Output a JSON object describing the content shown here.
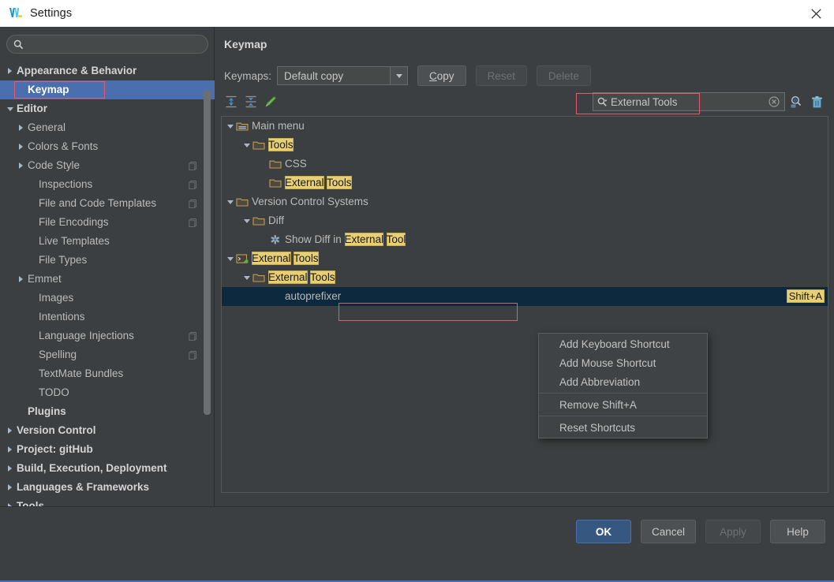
{
  "window": {
    "title": "Settings",
    "logo_icon": "webstorm-logo",
    "close_icon": "close-icon"
  },
  "sidebar": {
    "search": {
      "value": "",
      "placeholder": "",
      "icon": "search-icon"
    },
    "items": [
      {
        "label": "Appearance & Behavior",
        "arrow": "right",
        "bold": true,
        "indent": 0,
        "selected": false,
        "copy_icon": false
      },
      {
        "label": "Keymap",
        "arrow": "none",
        "bold": true,
        "indent": 1,
        "selected": true,
        "copy_icon": false
      },
      {
        "label": "Editor",
        "arrow": "down",
        "bold": true,
        "indent": 0,
        "selected": false,
        "copy_icon": false
      },
      {
        "label": "General",
        "arrow": "right",
        "bold": false,
        "indent": 1,
        "selected": false,
        "copy_icon": false
      },
      {
        "label": "Colors & Fonts",
        "arrow": "right",
        "bold": false,
        "indent": 1,
        "selected": false,
        "copy_icon": false
      },
      {
        "label": "Code Style",
        "arrow": "right",
        "bold": false,
        "indent": 1,
        "selected": false,
        "copy_icon": true
      },
      {
        "label": "Inspections",
        "arrow": "none",
        "bold": false,
        "indent": 2,
        "selected": false,
        "copy_icon": true
      },
      {
        "label": "File and Code Templates",
        "arrow": "none",
        "bold": false,
        "indent": 2,
        "selected": false,
        "copy_icon": true
      },
      {
        "label": "File Encodings",
        "arrow": "none",
        "bold": false,
        "indent": 2,
        "selected": false,
        "copy_icon": true
      },
      {
        "label": "Live Templates",
        "arrow": "none",
        "bold": false,
        "indent": 2,
        "selected": false,
        "copy_icon": false
      },
      {
        "label": "File Types",
        "arrow": "none",
        "bold": false,
        "indent": 2,
        "selected": false,
        "copy_icon": false
      },
      {
        "label": "Emmet",
        "arrow": "right",
        "bold": false,
        "indent": 1,
        "selected": false,
        "copy_icon": false
      },
      {
        "label": "Images",
        "arrow": "none",
        "bold": false,
        "indent": 2,
        "selected": false,
        "copy_icon": false
      },
      {
        "label": "Intentions",
        "arrow": "none",
        "bold": false,
        "indent": 2,
        "selected": false,
        "copy_icon": false
      },
      {
        "label": "Language Injections",
        "arrow": "none",
        "bold": false,
        "indent": 2,
        "selected": false,
        "copy_icon": true
      },
      {
        "label": "Spelling",
        "arrow": "none",
        "bold": false,
        "indent": 2,
        "selected": false,
        "copy_icon": true
      },
      {
        "label": "TextMate Bundles",
        "arrow": "none",
        "bold": false,
        "indent": 2,
        "selected": false,
        "copy_icon": false
      },
      {
        "label": "TODO",
        "arrow": "none",
        "bold": false,
        "indent": 2,
        "selected": false,
        "copy_icon": false
      },
      {
        "label": "Plugins",
        "arrow": "none",
        "bold": true,
        "indent": 1,
        "selected": false,
        "copy_icon": false
      },
      {
        "label": "Version Control",
        "arrow": "right",
        "bold": true,
        "indent": 0,
        "selected": false,
        "copy_icon": false
      },
      {
        "label": "Project: gitHub",
        "arrow": "right",
        "bold": true,
        "indent": 0,
        "selected": false,
        "copy_icon": false
      },
      {
        "label": "Build, Execution, Deployment",
        "arrow": "right",
        "bold": true,
        "indent": 0,
        "selected": false,
        "copy_icon": false
      },
      {
        "label": "Languages & Frameworks",
        "arrow": "right",
        "bold": true,
        "indent": 0,
        "selected": false,
        "copy_icon": false
      },
      {
        "label": "Tools",
        "arrow": "right",
        "bold": true,
        "indent": 0,
        "selected": false,
        "copy_icon": false
      }
    ]
  },
  "main": {
    "title": "Keymap",
    "keymaps_label": "Keymaps:",
    "keymap_selected": "Default copy",
    "buttons": {
      "copy": {
        "label": "Copy",
        "mnemonic": "C",
        "rest": "opy",
        "enabled": true
      },
      "reset": {
        "label": "Reset",
        "enabled": false
      },
      "delete": {
        "label": "Delete",
        "enabled": false
      }
    },
    "toolbar": [
      {
        "name": "expand-all-icon",
        "title": "Expand All"
      },
      {
        "name": "collapse-all-icon",
        "title": "Collapse All"
      },
      {
        "name": "edit-shortcut-icon",
        "title": "Edit Shortcut"
      }
    ],
    "search": {
      "value": "External Tools",
      "icon": "search-icon",
      "clear_icon": "clear-icon",
      "filter_icon": "find-shortcut-icon",
      "trash_icon": "trash-icon"
    }
  },
  "tree": {
    "rows": [
      {
        "indent": 0,
        "arrow": "down",
        "icon": "main-menu-icon",
        "parts": [
          {
            "t": "Main menu",
            "h": false
          }
        ],
        "selected": false,
        "shortcut": ""
      },
      {
        "indent": 1,
        "arrow": "down",
        "icon": "folder-icon",
        "parts": [
          {
            "t": "Tools",
            "h": true
          }
        ],
        "selected": false,
        "shortcut": ""
      },
      {
        "indent": 2,
        "arrow": "none",
        "icon": "folder-icon",
        "parts": [
          {
            "t": "CSS",
            "h": false
          }
        ],
        "selected": false,
        "shortcut": ""
      },
      {
        "indent": 2,
        "arrow": "none",
        "icon": "folder-icon",
        "parts": [
          {
            "t": "External",
            "h": true
          },
          {
            "t": " ",
            "h": false
          },
          {
            "t": "Tools",
            "h": true
          }
        ],
        "selected": false,
        "shortcut": ""
      },
      {
        "indent": 0,
        "arrow": "down",
        "icon": "folder-icon",
        "parts": [
          {
            "t": "Version Control Systems",
            "h": false
          }
        ],
        "selected": false,
        "shortcut": ""
      },
      {
        "indent": 1,
        "arrow": "down",
        "icon": "folder-icon",
        "parts": [
          {
            "t": "Diff",
            "h": false
          }
        ],
        "selected": false,
        "shortcut": ""
      },
      {
        "indent": 2,
        "arrow": "none",
        "icon": "action-diff-icon",
        "parts": [
          {
            "t": "Show Diff in ",
            "h": false
          },
          {
            "t": "External",
            "h": true
          },
          {
            "t": " ",
            "h": false
          },
          {
            "t": "Tool",
            "h": true
          }
        ],
        "selected": false,
        "shortcut": ""
      },
      {
        "indent": 0,
        "arrow": "down",
        "icon": "external-tools-icon",
        "parts": [
          {
            "t": "External",
            "h": true
          },
          {
            "t": " ",
            "h": false
          },
          {
            "t": "Tools",
            "h": true
          }
        ],
        "selected": false,
        "shortcut": ""
      },
      {
        "indent": 1,
        "arrow": "down",
        "icon": "folder-icon",
        "parts": [
          {
            "t": "External",
            "h": true
          },
          {
            "t": " ",
            "h": false
          },
          {
            "t": "Tools",
            "h": true
          }
        ],
        "selected": false,
        "shortcut": ""
      },
      {
        "indent": 2,
        "arrow": "none",
        "icon": "none",
        "parts": [
          {
            "t": "autoprefixer",
            "h": false
          }
        ],
        "selected": true,
        "shortcut": "Shift+A"
      }
    ]
  },
  "context_menu": {
    "items": [
      {
        "label": "Add Keyboard Shortcut",
        "sep_after": false,
        "highlighted": true
      },
      {
        "label": "Add Mouse Shortcut",
        "sep_after": false,
        "highlighted": false
      },
      {
        "label": "Add Abbreviation",
        "sep_after": true,
        "highlighted": false
      },
      {
        "label": "Remove Shift+A",
        "sep_after": true,
        "highlighted": false
      },
      {
        "label": "Reset Shortcuts",
        "sep_after": false,
        "highlighted": false
      }
    ]
  },
  "footer": {
    "ok": "OK",
    "cancel": "Cancel",
    "apply": "Apply",
    "help": "Help",
    "apply_enabled": false
  },
  "colors": {
    "accent_selection": "#4b6eaf",
    "tree_selection": "#0d293e",
    "highlight_match": "#e8cf74",
    "annotation_box": "#e35b6e",
    "panel_bg": "#3c3f41"
  }
}
